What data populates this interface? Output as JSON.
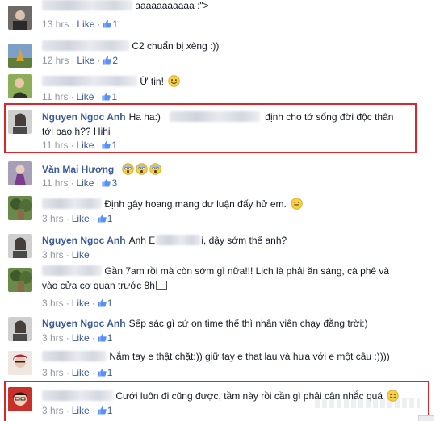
{
  "ui": {
    "like_label": "Like",
    "separator": "·"
  },
  "comments": [
    {
      "author": "",
      "text": "aaaaaaaaaaa :\">",
      "time": "13 hrs",
      "likes": "1",
      "emoji": ""
    },
    {
      "author": "",
      "text": "C2 chuẩn bị xèng :))",
      "time": "12 hrs",
      "likes": "2",
      "emoji": ""
    },
    {
      "author": "",
      "text": "Ừ tin!",
      "time": "11 hrs",
      "likes": "1",
      "emoji": "smile"
    },
    {
      "author": "Nguyen Ngoc Anh",
      "text_a": "Ha ha:)",
      "text_b": "định cho tớ sống đời độc thân",
      "text_c": "tới bao h?? Hihi",
      "time": "11 hrs",
      "likes": "1",
      "emoji": ""
    },
    {
      "author": "Văn Mai Hương",
      "text": "",
      "time": "11 hrs",
      "likes": "3",
      "emoji": "scream"
    },
    {
      "author": "",
      "text": "Định gây hoang mang dư luận đấy hử em.",
      "time": "3 hrs",
      "likes": "1",
      "emoji": "tongue"
    },
    {
      "author": "Nguyen Ngoc Anh",
      "text_a": "Anh E",
      "text_b": "i, dậy sớm thế anh?",
      "time": "3 hrs",
      "likes": "",
      "emoji": ""
    },
    {
      "author": "",
      "text_a": "Gần 7am rồi mà còn sớm gì nữa!!! Lịch là phải ăn sáng, cà phê và",
      "text_c": "vào cửa cơ quan trước 8h",
      "time": "3 hrs",
      "likes": "1",
      "emoji": ""
    },
    {
      "author": "Nguyen Ngoc Anh",
      "text": "Sếp sác gì cứ on time thế thì nhân viên chạy đằng trời:)",
      "time": "3 hrs",
      "likes": "1",
      "emoji": ""
    },
    {
      "author": "",
      "text": "Nắm tay e thật chặt:)) giữ tay e that lau và hưa với e một câu :))))",
      "time": "3 hrs",
      "likes": "1",
      "emoji": ""
    },
    {
      "author": "",
      "text": "Cưới luôn đi cũng được, tầm này rồi cần gì phải cân nhắc quá",
      "time": "3 hrs",
      "likes": "1",
      "emoji": "wink"
    }
  ],
  "colors": {
    "link": "#3b5998",
    "meta": "#9197a3",
    "highlight_box": "#d8262b",
    "text": "#141823"
  }
}
